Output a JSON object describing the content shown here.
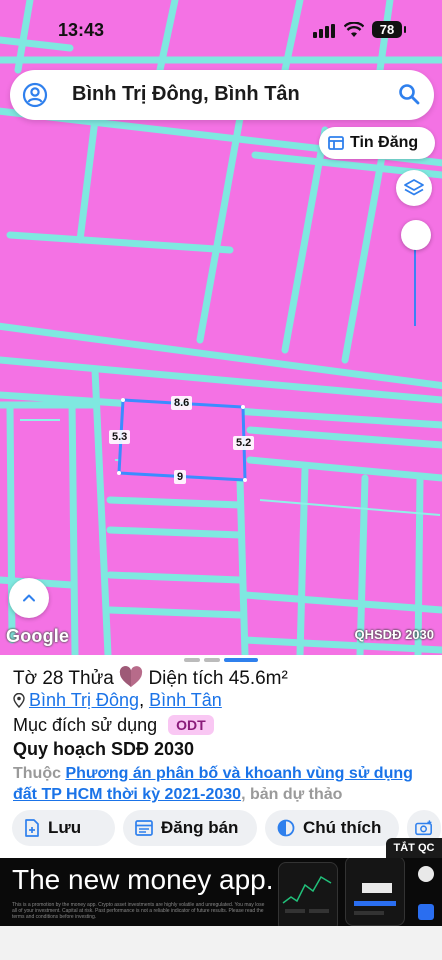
{
  "status_bar": {
    "time": "13:43",
    "battery": "78"
  },
  "search": {
    "location": "Bình Trị Đông, Bình Tân"
  },
  "map": {
    "tin_dang_label": "Tin Đăng",
    "google_label": "Google",
    "plan_tag": "QHSDĐ 2030",
    "parcel_dimensions": {
      "top": "8.6",
      "left": "5.3",
      "right": "5.2",
      "bottom": "9"
    },
    "colors": {
      "land": "#f472e4",
      "roads": "#7fe8e0",
      "parcel_outline": "#3b8cff"
    }
  },
  "sheet": {
    "title_prefix": "Tờ 28 Thửa",
    "title_area": "Diện tích 45.6m²",
    "ward_link": "Bình Trị Đông",
    "separator": ",",
    "district_link": "Bình Tân",
    "purpose_label": "Mục đích sử dụng",
    "purpose_code": "ODT",
    "plan_heading": "Quy hoạch SDĐ 2030",
    "belongs_prefix": "Thuộc",
    "plan_link": "Phương án phân bố và khoanh vùng sử dụng đất TP HCM thời kỳ 2021-2030",
    "plan_suffix": ", bản dự thảo",
    "actions": {
      "save": "Lưu",
      "post_sale": "Đăng bán",
      "legend": "Chú thích"
    }
  },
  "ad": {
    "close_label": "TẮT QC",
    "headline": "The new money app.",
    "fine_print": "This is a promotion by the money app. Crypto asset investments are highly volatile and unregulated. You may lose all of your investment. Capital at risk. Past performance is not a reliable indicator of future results. Please read the terms and conditions before investing."
  }
}
